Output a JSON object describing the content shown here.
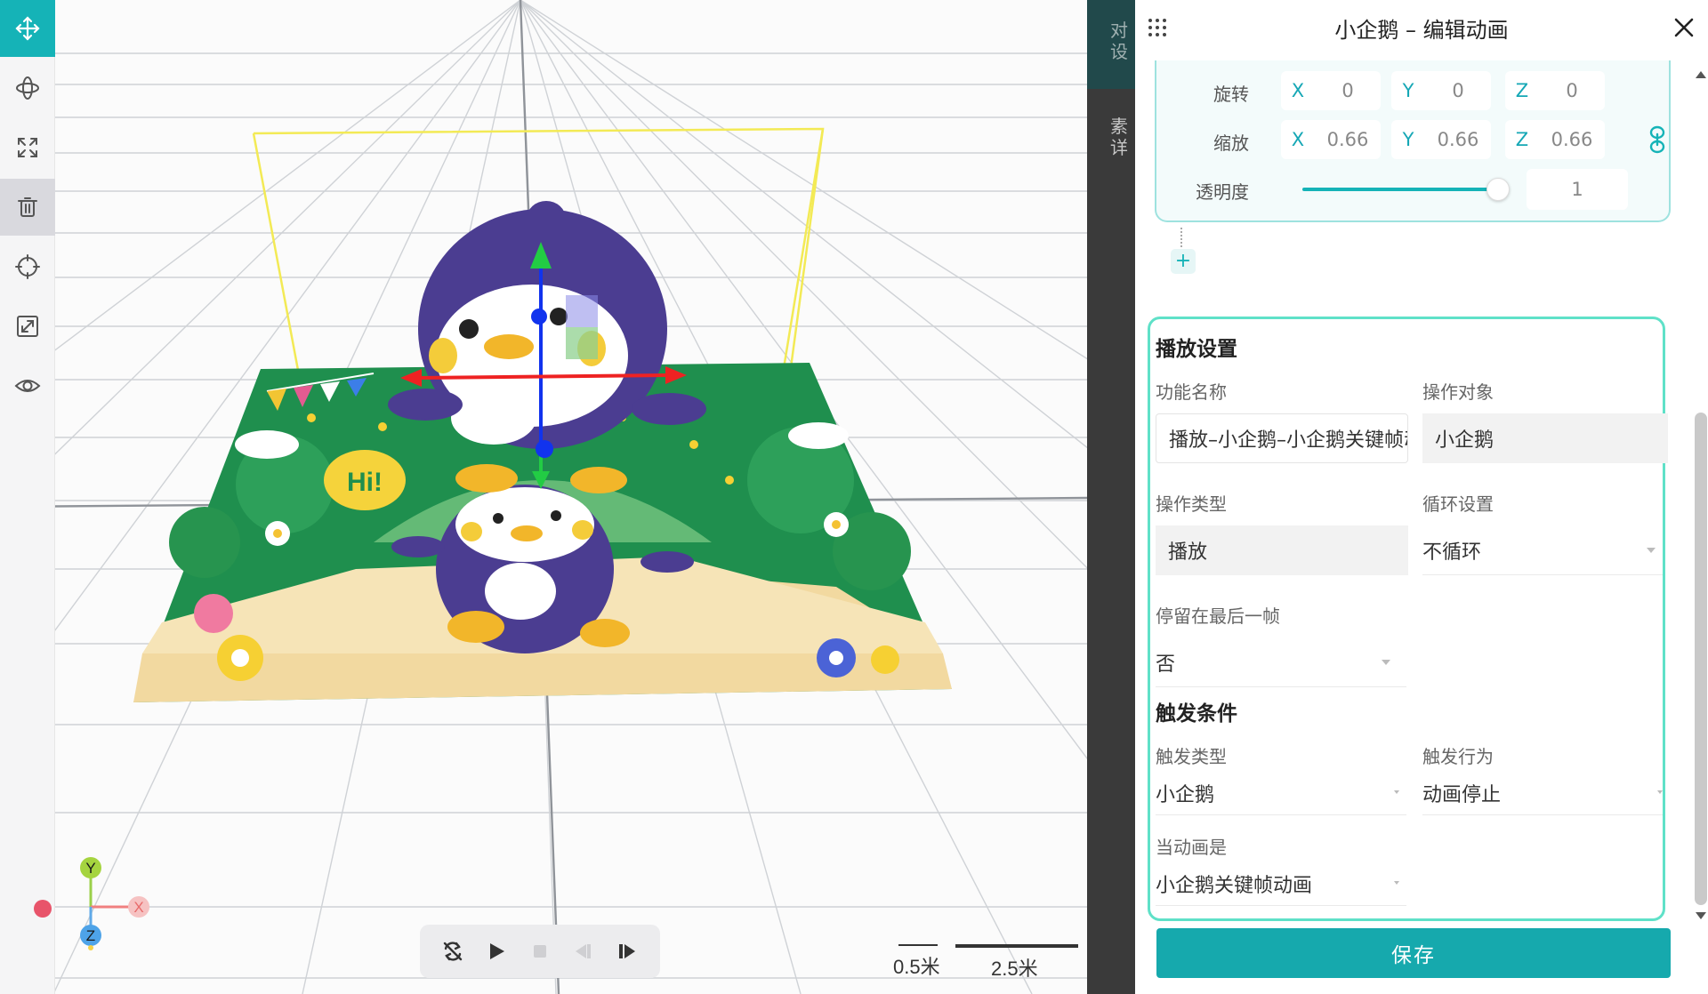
{
  "panel": {
    "title": "小企鹅 – 编辑动画",
    "close_icon": "close-icon",
    "drag_icon": "drag-handle-icon"
  },
  "backdrop": {
    "top_text": "对设",
    "side_text": "素详"
  },
  "transform": {
    "rotation_label": "旋转",
    "rotation": {
      "x_axis": "X",
      "x": "0",
      "y_axis": "Y",
      "y": "0",
      "z_axis": "Z",
      "z": "0"
    },
    "scale_label": "缩放",
    "scale": {
      "x_axis": "X",
      "x": "0.66",
      "y_axis": "Y",
      "y": "0.66",
      "z_axis": "Z",
      "z": "0.66"
    },
    "opacity_label": "透明度",
    "opacity_value": "1",
    "opacity_fraction": 1.0
  },
  "add_step_label": "+",
  "playback_settings": {
    "section_title": "播放设置",
    "function_name_label": "功能名称",
    "function_name_value": "播放–小企鹅–小企鹅关键帧动画",
    "target_label": "操作对象",
    "target_value": "小企鹅",
    "operation_type_label": "操作类型",
    "operation_type_value": "播放",
    "loop_label": "循环设置",
    "loop_value": "不循环",
    "stay_last_frame_label": "停留在最后一帧",
    "stay_last_frame_value": "否"
  },
  "trigger": {
    "section_title": "触发条件",
    "trigger_type_label": "触发类型",
    "trigger_type_value": "小企鹅",
    "trigger_action_label": "触发行为",
    "trigger_action_value": "动画停止",
    "when_animation_label": "当动画是",
    "when_animation_value": "小企鹅关键帧动画"
  },
  "save_label": "保存",
  "viewport": {
    "scale_small": "0.5米",
    "scale_large": "2.5米",
    "axis_labels": {
      "y": "Y",
      "x": "X",
      "z": "Z"
    },
    "sign_text": "Hi!",
    "colors": {
      "accent": "#15b3b7",
      "grass": "#1f8f4e",
      "penguin": "#4b3d91",
      "gizmo_y": "#22cc44",
      "gizmo_x": "#ee2222",
      "gizmo_z": "#1133ee"
    }
  },
  "toolbar": {
    "tools": [
      "move-icon",
      "rotate-icon",
      "scale-icon",
      "delete-icon",
      "focus-icon",
      "fit-icon",
      "visibility-icon"
    ]
  },
  "playback_controls": [
    "loop-off-icon",
    "play-icon",
    "stop-icon",
    "step-back-icon",
    "step-forward-icon"
  ]
}
